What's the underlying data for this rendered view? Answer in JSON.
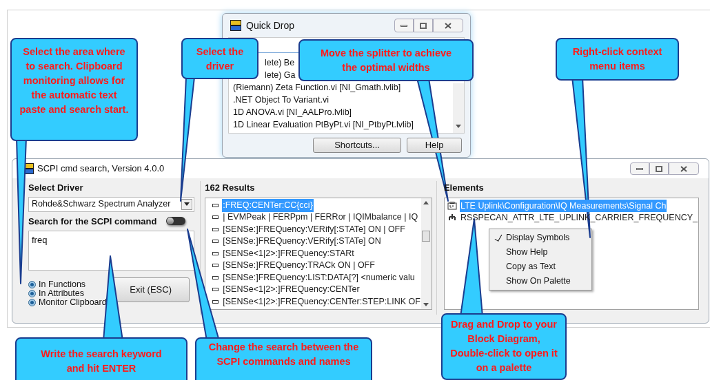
{
  "quick_drop": {
    "title": "Quick Drop",
    "items": [
      "lete) Be",
      "lete) Ga",
      "(Riemann) Zeta Function.vi [NI_Gmath.lvlib]",
      ".NET Object To Variant.vi",
      "1D ANOVA.vi [NI_AALPro.lvlib]",
      "1D Linear Evaluation PtByPt.vi [NI_PtbyPt.lvlib]"
    ],
    "buttons": [
      "Shortcuts...",
      "Help"
    ]
  },
  "window": {
    "title": "SCPI cmd search, Version 4.0.0"
  },
  "left_panel": {
    "driver_label": "Select Driver",
    "driver_value": "Rohde&Schwarz Spectrum Analyzer",
    "search_label": "Search for the SCPI command",
    "search_value": "freq",
    "search_toggle": {
      "on": false
    },
    "options": [
      {
        "label": "In Functions",
        "on": true
      },
      {
        "label": "In Attributes",
        "on": true
      },
      {
        "label": "Monitor Clipboard",
        "on": true
      }
    ],
    "exit_button": "Exit (ESC)"
  },
  "results": {
    "heading": "162 Results",
    "items": [
      {
        "text": ":FREQ:CENTer:CC{cci}",
        "selected": true
      },
      {
        "text": "| EVMPeak | FERPpm | FERRor | IQIMbalance | IQ",
        "selected": false
      },
      {
        "text": "[SENSe:]FREQuency:VERify[:STATe] ON | OFF",
        "selected": false
      },
      {
        "text": "[SENSe:]FREQuency:VERify[:STATe] ON",
        "selected": false
      },
      {
        "text": "[SENSe<1|2>:]FREQuency:STARt",
        "selected": false
      },
      {
        "text": "[SENSe:]FREQuency:TRACk ON | OFF",
        "selected": false
      },
      {
        "text": "[SENSe:]FREQuency:LIST:DATA[?] <numeric valu",
        "selected": false
      },
      {
        "text": "[SENSe<1|2>:]FREQuency:CENTer",
        "selected": false
      },
      {
        "text": "[SENSe<1|2>:]FREQuency:CENTer:STEP:LINK OF",
        "selected": false
      }
    ]
  },
  "elements": {
    "heading": "Elements",
    "items": [
      {
        "text": "LTE Uplink\\Configuration\\IQ Measurements\\Signal Ch",
        "kind": "function",
        "selected": true
      },
      {
        "text": "RSSPECAN_ATTR_LTE_UPLINK_CARRIER_FREQUENCY_",
        "kind": "attribute",
        "selected": false
      }
    ]
  },
  "context_menu": [
    {
      "label": "Display Symbols",
      "checked": true
    },
    {
      "label": "Show Help",
      "checked": false
    },
    {
      "label": "Copy as Text",
      "checked": false
    },
    {
      "label": "Show On Palette",
      "checked": false
    }
  ],
  "callouts": [
    {
      "text": "Select the area where to search. Clipboard monitoring allows for the automatic text paste and search start."
    },
    {
      "text": "Select the driver"
    },
    {
      "text": "Move the splitter to achieve the optimal widths"
    },
    {
      "text": "Right-click context menu items"
    },
    {
      "text": "Write the search keyword and hit ENTER"
    },
    {
      "text": "Change the search between the SCPI commands and names"
    },
    {
      "text": "Drag and Drop to your Block Diagram, Double-click to open it on a palette"
    }
  ]
}
